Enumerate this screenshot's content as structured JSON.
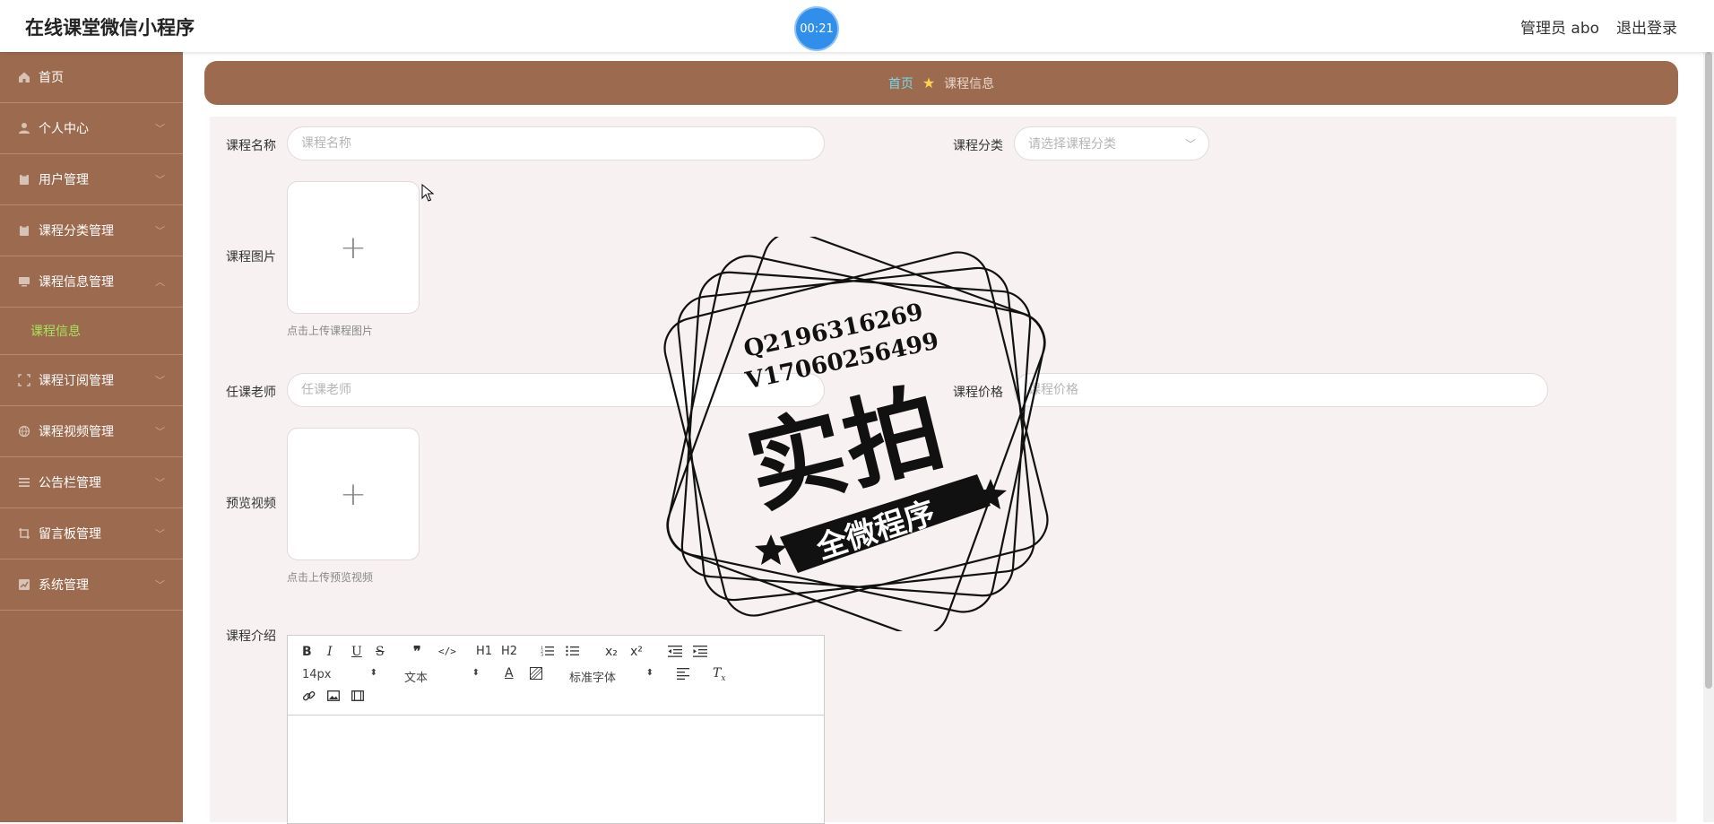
{
  "header": {
    "app_title": "在线课堂微信小程序",
    "timer": "00:21",
    "user_label": "管理员 abo",
    "logout_label": "退出登录"
  },
  "sidebar": {
    "items": [
      {
        "label": "首页",
        "icon": "home-icon"
      },
      {
        "label": "个人中心",
        "icon": "user-icon"
      },
      {
        "label": "用户管理",
        "icon": "clipboard-icon"
      },
      {
        "label": "课程分类管理",
        "icon": "clipboard-icon"
      },
      {
        "label": "课程信息管理",
        "icon": "monitor-icon"
      },
      {
        "label": "课程订阅管理",
        "icon": "frame-icon"
      },
      {
        "label": "课程视频管理",
        "icon": "globe-icon"
      },
      {
        "label": "公告栏管理",
        "icon": "list-icon"
      },
      {
        "label": "留言板管理",
        "icon": "crop-icon"
      },
      {
        "label": "系统管理",
        "icon": "chart-icon"
      }
    ],
    "sub_item": "课程信息"
  },
  "breadcrumb": {
    "home": "首页",
    "current": "课程信息"
  },
  "form": {
    "course_name_label": "课程名称",
    "course_name_placeholder": "课程名称",
    "category_label": "课程分类",
    "category_placeholder": "请选择课程分类",
    "image_label": "课程图片",
    "image_hint": "点击上传课程图片",
    "teacher_label": "任课老师",
    "teacher_placeholder": "任课老师",
    "price_label": "课程价格",
    "price_placeholder": "课程价格",
    "video_label": "预览视频",
    "video_hint": "点击上传预览视频",
    "intro_label": "课程介绍"
  },
  "editor": {
    "font_size": "14px",
    "paragraph": "文本",
    "font_family": "标准字体",
    "buttons": [
      "B",
      "I",
      "U",
      "S",
      "❞",
      "</>",
      "H1",
      "H2",
      "ol",
      "ul",
      "x₂",
      "x²",
      "outdent",
      "indent"
    ]
  },
  "watermark": {
    "line1": "Q2196316269",
    "line2": "V17060256499",
    "big": "实拍",
    "ribbon": "全微程序"
  },
  "colors": {
    "sidebar_bg": "#9c6b4f",
    "active_sub": "#a7e35b",
    "breadcrumb_home": "#7ad7e9",
    "timer": "#2f8fea"
  }
}
